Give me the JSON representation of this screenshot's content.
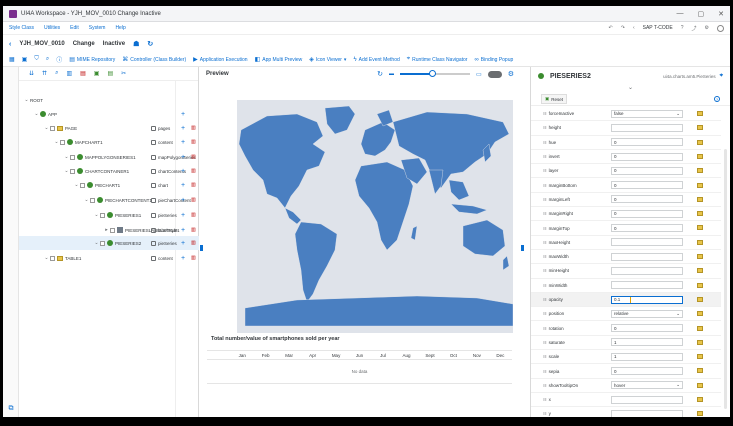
{
  "window": {
    "title": "UI4A Workspace - YJH_MOV_0010 Change Inactive",
    "controls": [
      "—",
      "▢",
      "✕"
    ]
  },
  "menu": [
    "Style Class",
    "Utilities",
    "Edit",
    "System",
    "Help"
  ],
  "menu_right": {
    "sap_code": "SAP T-CODE"
  },
  "object": {
    "name": "YJH_MOV_0010",
    "mode": "Change",
    "status": "Inactive"
  },
  "toolbar": [
    "MIME Repository",
    "Controller (Class Builder)",
    "Application Execution",
    "App Multi Preview",
    "Icon Viewer",
    "Add Event Method",
    "Runtime Class Navigator",
    "Binding Popup"
  ],
  "tree": {
    "rows": [
      {
        "label": "ROOT",
        "aggr": "",
        "type": "none"
      },
      {
        "label": "APP",
        "aggr": "",
        "type": "green"
      },
      {
        "label": "PAGE",
        "aggr": "pages",
        "type": "folder"
      },
      {
        "label": "MAPCHART1",
        "aggr": "content",
        "type": "green"
      },
      {
        "label": "MAPPOLYGONSERIES1",
        "aggr": "mapPolygonSeries",
        "type": "green"
      },
      {
        "label": "CHARTCONTAINER1",
        "aggr": "chartContents",
        "type": "green"
      },
      {
        "label": "PIECHART1",
        "aggr": "chart",
        "type": "green"
      },
      {
        "label": "PIECHARTCONTENT1",
        "aggr": "pieChartContent",
        "type": "green"
      },
      {
        "label": "PIESERIES1",
        "aggr": "pieSeries",
        "type": "green"
      },
      {
        "label": "PIESERIESLABELSTYLE1",
        "aggr": "labelStyle",
        "type": "box"
      },
      {
        "label": "PIESERIES2",
        "aggr": "pieSeries",
        "type": "green"
      },
      {
        "label": "TABLE1",
        "aggr": "content",
        "type": "folder"
      }
    ]
  },
  "preview": {
    "title": "Preview",
    "chart_title": "Total number/value of smartphones sold per year",
    "months": [
      "Jan",
      "Feb",
      "Mar",
      "Apr",
      "May",
      "Jun",
      "Jul",
      "Aug",
      "Sept",
      "Oct",
      "Nov",
      "Dec"
    ],
    "no_data": "No data",
    "zoom_fraction": 0.45
  },
  "properties": {
    "title": "PIESERIES2",
    "class": "ui4a.charts.am5.PieSeries",
    "reset": "Reset",
    "rows": [
      {
        "name": "forceInactive",
        "kind": "select",
        "value": "false"
      },
      {
        "name": "height",
        "kind": "input",
        "value": ""
      },
      {
        "name": "hue",
        "kind": "input",
        "value": "0"
      },
      {
        "name": "invert",
        "kind": "input",
        "value": "0"
      },
      {
        "name": "layer",
        "kind": "input",
        "value": "0"
      },
      {
        "name": "marginBottom",
        "kind": "input",
        "value": "0"
      },
      {
        "name": "marginLeft",
        "kind": "input",
        "value": "0"
      },
      {
        "name": "marginRight",
        "kind": "input",
        "value": "0"
      },
      {
        "name": "marginTop",
        "kind": "input",
        "value": "0"
      },
      {
        "name": "maxHeight",
        "kind": "input",
        "value": ""
      },
      {
        "name": "maxWidth",
        "kind": "input",
        "value": ""
      },
      {
        "name": "minHeight",
        "kind": "input",
        "value": ""
      },
      {
        "name": "minWidth",
        "kind": "input",
        "value": ""
      },
      {
        "name": "opacity",
        "kind": "input",
        "value": "0.1"
      },
      {
        "name": "position",
        "kind": "select",
        "value": "relative"
      },
      {
        "name": "rotation",
        "kind": "input",
        "value": "0"
      },
      {
        "name": "saturate",
        "kind": "input",
        "value": "1"
      },
      {
        "name": "scale",
        "kind": "input",
        "value": "1"
      },
      {
        "name": "sepia",
        "kind": "input",
        "value": "0"
      },
      {
        "name": "showTooltipOn",
        "kind": "select",
        "value": "hover"
      },
      {
        "name": "x",
        "kind": "input",
        "value": ""
      },
      {
        "name": "y",
        "kind": "input",
        "value": ""
      }
    ]
  }
}
